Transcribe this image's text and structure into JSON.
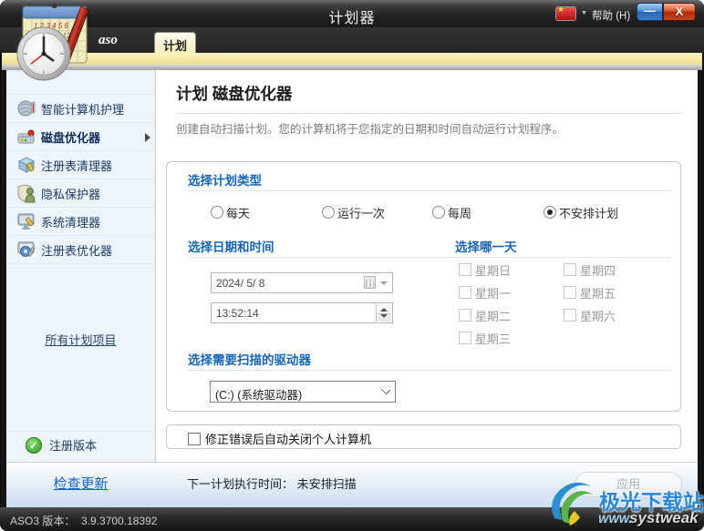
{
  "window": {
    "title": "计划器",
    "help_label": "帮助 (H)",
    "minimize_glyph": "—",
    "close_glyph": "X",
    "status_left": "ASO3 版本：  3.9.3700.18392"
  },
  "tabs": {
    "aso": "aso",
    "schedule": "计划"
  },
  "sidebar": {
    "items": [
      {
        "label": "智能计算机护理"
      },
      {
        "label": "磁盘优化器"
      },
      {
        "label": "注册表清理器"
      },
      {
        "label": "隐私保护器"
      },
      {
        "label": "系统清理器"
      },
      {
        "label": "注册表优化器"
      }
    ],
    "all_schedules_link": "所有计划项目",
    "registered_label": "注册版本",
    "check_update_link": "检查更新"
  },
  "main": {
    "title": "计划 磁盘优化器",
    "description": "创建自动扫描计划。您的计算机将于您指定的日期和时间自动运行计划程序。",
    "schedule_type_heading": "选择计划类型",
    "options": [
      {
        "label": "每天",
        "selected": false
      },
      {
        "label": "运行一次",
        "selected": false
      },
      {
        "label": "每周",
        "selected": false
      },
      {
        "label": "不安排计划",
        "selected": true
      }
    ],
    "datetime_heading": "选择日期和时间",
    "date_value": "2024/ 5/ 8",
    "time_value": "13:52:14",
    "dayselect_heading": "选择哪一天",
    "days": [
      "星期日",
      "星期一",
      "星期二",
      "星期三",
      "星期四",
      "星期五",
      "星期六"
    ],
    "drive_heading": "选择需要扫描的驱动器",
    "drive_value": "(C:) (系统驱动器)",
    "shutdown_label": "修正错误后自动关闭个人计算机",
    "next_run": "下一计划执行时间： 未安排扫描",
    "apply_label": "应用"
  },
  "watermark": {
    "site": "极光下载站",
    "www": "WWW.",
    "brand": "systweak"
  }
}
